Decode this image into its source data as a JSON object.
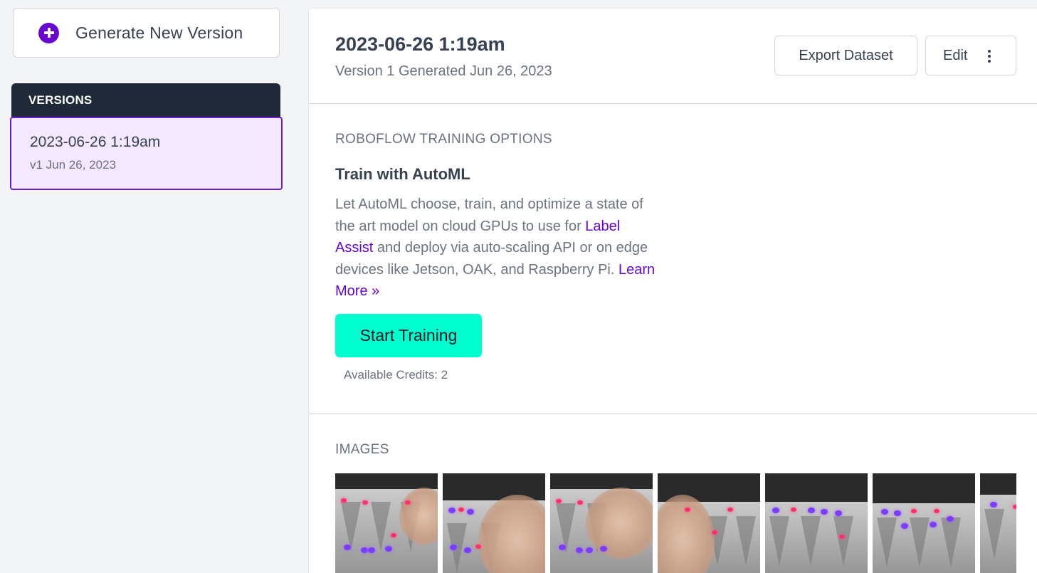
{
  "sidebar": {
    "generate_label": "Generate New Version",
    "versions_heading": "VERSIONS",
    "items": [
      {
        "title": "2023-06-26 1:19am",
        "subtitle": "v1 Jun 26, 2023"
      }
    ]
  },
  "header": {
    "title": "2023-06-26 1:19am",
    "subtitle": "Version 1 Generated Jun 26, 2023",
    "export_label": "Export Dataset",
    "edit_label": "Edit"
  },
  "training": {
    "section_label": "ROBOFLOW TRAINING OPTIONS",
    "heading": "Train with AutoML",
    "desc_part1": "Let AutoML choose, train, and optimize a state of the art model on cloud GPUs to use for ",
    "label_assist_link": "Label Assist",
    "desc_part2": " and deploy via auto-scaling API or on edge devices like Jetson, OAK, and Raspberry Pi. ",
    "learn_more_link": "Learn More »",
    "start_button": "Start Training",
    "credits": "Available Credits: 2"
  },
  "images": {
    "section_label": "IMAGES",
    "thumbnail_count": 7
  },
  "colors": {
    "accent": "#6706ce",
    "start_button": "#00ffce",
    "sidebar_header": "#1f2937",
    "selected_version_bg": "#f3e8ff"
  },
  "icons": [
    "plus-circle-icon",
    "kebab-menu-icon",
    "double-chevron-right-icon"
  ]
}
